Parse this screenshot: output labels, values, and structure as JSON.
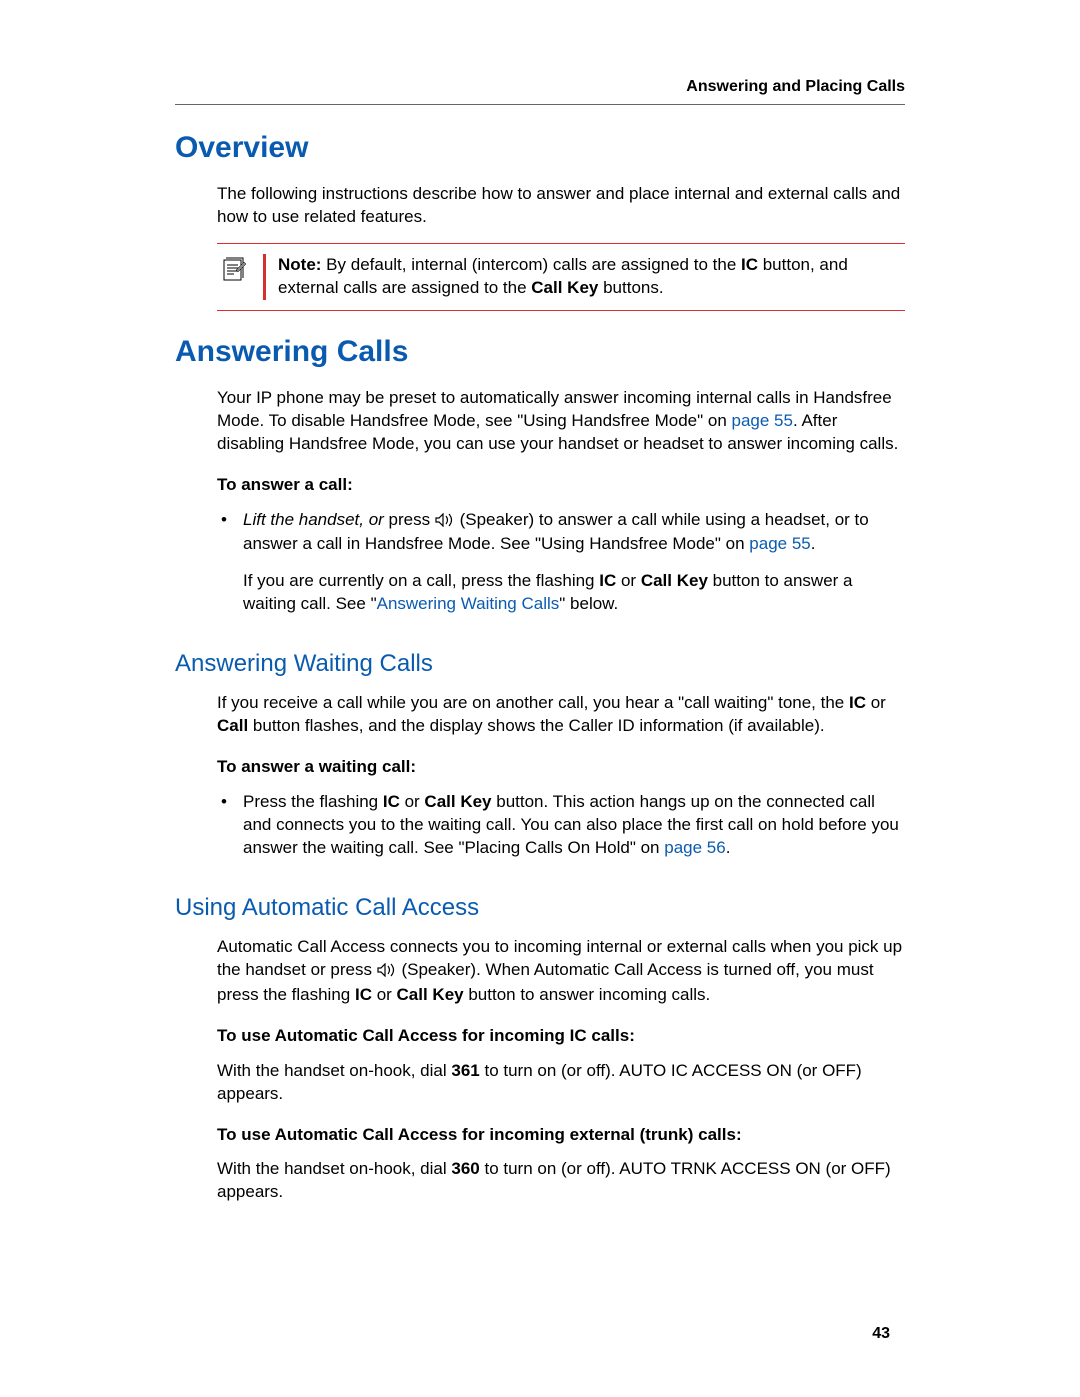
{
  "header": {
    "running": "Answering and Placing Calls",
    "page_number": "43"
  },
  "overview": {
    "title": "Overview",
    "para": "The following instructions describe how to answer and place internal and external calls and how to use related features.",
    "note": {
      "label": "Note:",
      "text1": " By default, internal (intercom) calls are assigned to the ",
      "bold1": "IC",
      "text2": " button, and external calls are assigned to the ",
      "bold2": "Call Key",
      "text3": " buttons."
    }
  },
  "answering": {
    "title": "Answering Calls",
    "para1a": "Your IP phone may be preset to automatically answer incoming internal calls in Handsfree Mode. To disable Handsfree Mode, see \"Using Handsfree Mode\" on ",
    "para1_link": "page 55",
    "para1b": ". After disabling Handsfree Mode, you can use your handset or headset to answer incoming calls.",
    "task1": "To answer a call:",
    "bullet1": {
      "italic": "Lift the handset, or ",
      "text1": "press ",
      "text2": " (Speaker) to answer a call while using a headset, or to answer a call in Handsfree Mode. See \"Using Handsfree Mode\" on ",
      "link": "page 55",
      "text3": ".",
      "para2a": "If you are currently on a call, press the flashing ",
      "bold1": "IC",
      "para2b": " or ",
      "bold2": "Call Key",
      "para2c": " button to answer a waiting call. See \"",
      "link2": "Answering Waiting Calls",
      "para2d": "\" below."
    }
  },
  "waiting": {
    "title": "Answering Waiting Calls",
    "para1a": "If you receive a call while you are on another call, you hear a \"call waiting\" tone, the ",
    "bold1": "IC",
    "para1b": " or ",
    "bold2": "Call",
    "para1c": " button flashes, and the display shows the Caller ID information (if available).",
    "task": "To answer a waiting call:",
    "bullet": {
      "text1": "Press the flashing ",
      "bold1": "IC",
      "text2": " or ",
      "bold2": "Call Key",
      "text3": " button. This action hangs up on the connected call and connects you to the waiting call. You can also place the first call on hold before you answer the waiting call. See \"Placing Calls On Hold\" on ",
      "link": "page 56",
      "text4": "."
    }
  },
  "auto": {
    "title": "Using Automatic Call Access",
    "para1a": "Automatic Call Access connects you to incoming internal or external calls when you pick up the handset or press ",
    "para1b": " (Speaker). When Automatic Call Access is turned off, you must press the flashing ",
    "bold1": "IC",
    "para1c": " or ",
    "bold2": "Call Key",
    "para1d": " button to answer incoming calls.",
    "task1": "To use Automatic Call Access for incoming IC calls:",
    "para2a": "With the handset on-hook, dial ",
    "bold3": "361",
    "para2b": " to turn on (or off). AUTO IC ACCESS ON (or OFF) appears.",
    "task2": "To use Automatic Call Access for incoming external (trunk) calls:",
    "para3a": "With the handset on-hook, dial ",
    "bold4": "360",
    "para3b": " to turn on (or off). AUTO TRNK ACCESS ON (or OFF) appears."
  }
}
